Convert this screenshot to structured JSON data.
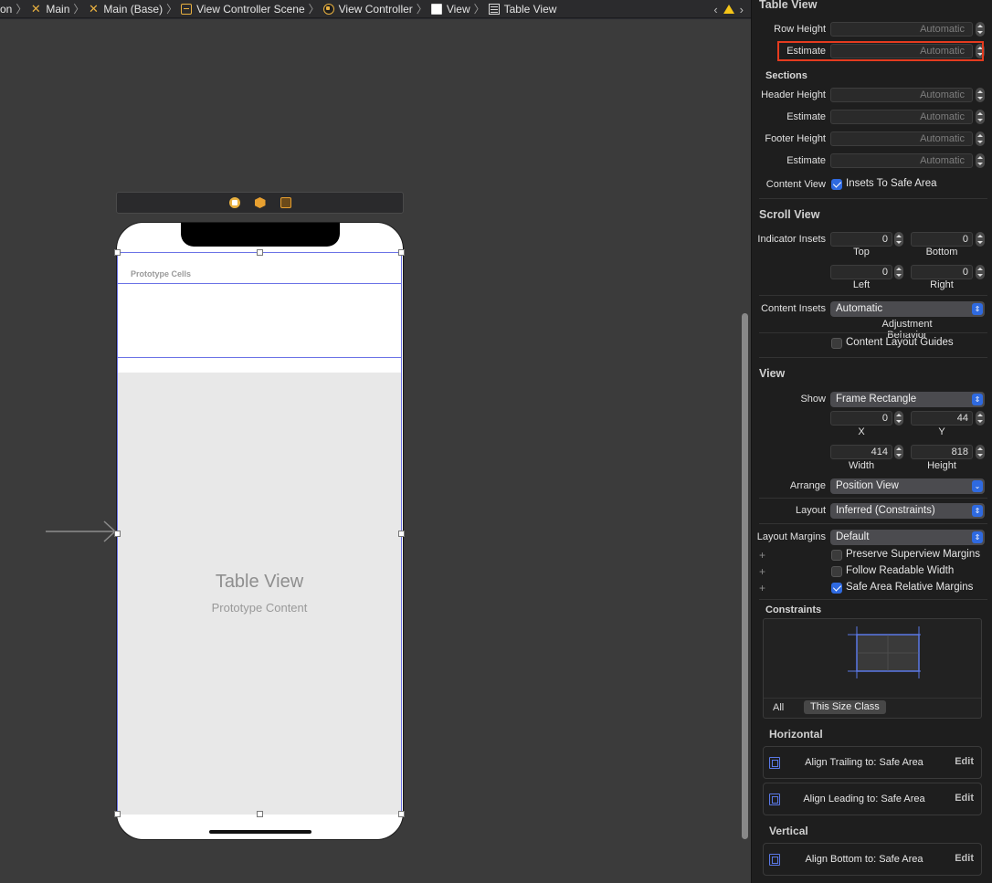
{
  "breadcrumb": [
    "on",
    "Main",
    "Main (Base)",
    "View Controller Scene",
    "View Controller",
    "View",
    "Table View"
  ],
  "canvas": {
    "prototype_cells_label": "Prototype Cells",
    "table_view_title": "Table View",
    "table_view_subtitle": "Prototype Content"
  },
  "inspector": {
    "table_view_header": "Table View",
    "row_height": {
      "label": "Row Height",
      "value": "Automatic"
    },
    "row_estimate": {
      "label": "Estimate",
      "value": "Automatic"
    },
    "sections_label": "Sections",
    "header_height": {
      "label": "Header Height",
      "value": "Automatic"
    },
    "header_estimate": {
      "label": "Estimate",
      "value": "Automatic"
    },
    "footer_height": {
      "label": "Footer Height",
      "value": "Automatic"
    },
    "footer_estimate": {
      "label": "Estimate",
      "value": "Automatic"
    },
    "content_view": {
      "label": "Content View",
      "checkbox": "Insets To Safe Area",
      "checked": true
    },
    "scroll_view_header": "Scroll View",
    "indicator_insets": {
      "label": "Indicator Insets",
      "top": "0",
      "bottom": "0",
      "left": "0",
      "right": "0",
      "top_caption": "Top",
      "bottom_caption": "Bottom",
      "left_caption": "Left",
      "right_caption": "Right"
    },
    "content_insets": {
      "label": "Content Insets",
      "value": "Automatic",
      "caption": "Adjustment Behavior"
    },
    "content_layout_guides": {
      "label": "Content Layout Guides",
      "checked": false
    },
    "view_header": "View",
    "show": {
      "label": "Show",
      "value": "Frame Rectangle"
    },
    "frame": {
      "x": "0",
      "y": "44",
      "width": "414",
      "height": "818",
      "x_caption": "X",
      "y_caption": "Y",
      "width_caption": "Width",
      "height_caption": "Height"
    },
    "arrange": {
      "label": "Arrange",
      "value": "Position View"
    },
    "layout": {
      "label": "Layout",
      "value": "Inferred (Constraints)"
    },
    "layout_margins": {
      "label": "Layout Margins",
      "value": "Default"
    },
    "preserve_superview_margins": {
      "label": "Preserve Superview Margins",
      "checked": false
    },
    "follow_readable_width": {
      "label": "Follow Readable Width",
      "checked": false
    },
    "safe_area_relative_margins": {
      "label": "Safe Area Relative Margins",
      "checked": true
    },
    "plus_sign": "+",
    "constraints_label": "Constraints",
    "constraint_tabs": {
      "all": "All",
      "size_class": "This Size Class"
    },
    "horizontal_header": "Horizontal",
    "vertical_header": "Vertical",
    "edit_label": "Edit",
    "constraints": [
      {
        "text": "Align Trailing to:  Safe Area"
      },
      {
        "text": "Align Leading to:  Safe Area"
      },
      {
        "text": "Align Bottom to:  Safe Area"
      }
    ]
  },
  "colors": {
    "canvas_bg": "#3b3b3b",
    "inspector_bg": "#1e1e1e",
    "accent_blue": "#2f6ae0",
    "selection_outline": "#6b73e6",
    "highlight_red": "#e53b1f",
    "warning_yellow": "#f5c518"
  }
}
